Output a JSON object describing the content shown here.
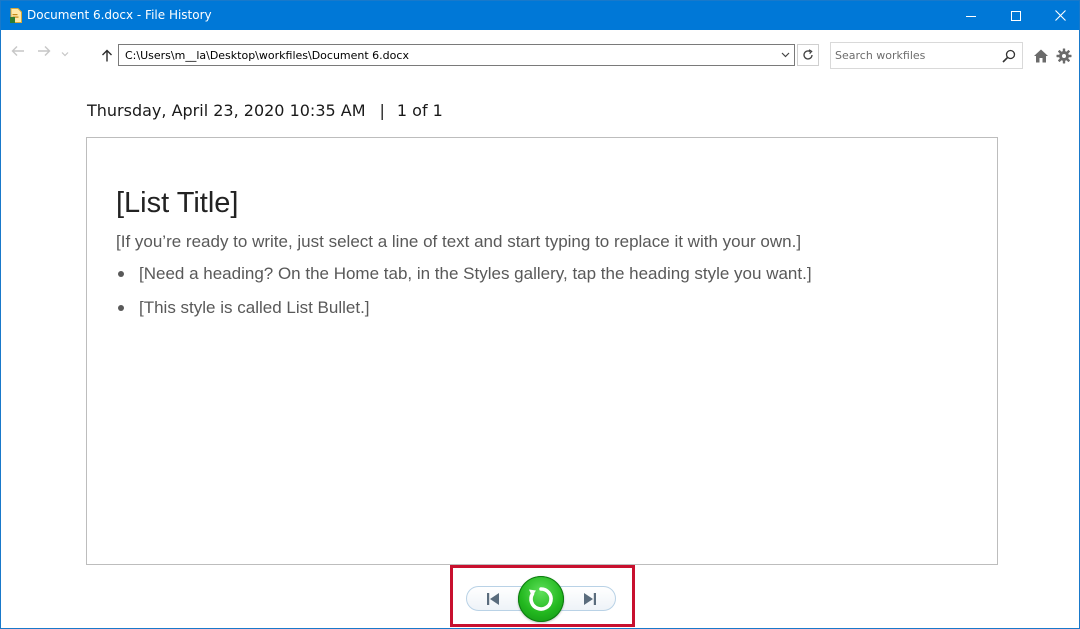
{
  "window": {
    "title": "Document 6.docx - File History",
    "accent": "#0078d7"
  },
  "nav": {
    "address_path": "C:\\Users\\m__la\\Desktop\\workfiles\\Document 6.docx",
    "search_placeholder": "Search workfiles"
  },
  "header": {
    "date": "Thursday, April 23, 2020 10:35 AM",
    "separator": "|",
    "position": "1 of 1"
  },
  "preview": {
    "title": "[List Title]",
    "intro": "[If you’re ready to write, just select a line of text and start typing to replace it with your own.]",
    "bullets": [
      "[Need a heading? On the Home tab, in the Styles gallery, tap the heading style you want.]",
      "[This style is called List Bullet.]"
    ]
  },
  "controls": {
    "highlight_color": "#c8102e",
    "restore_color": "#23b81f"
  }
}
